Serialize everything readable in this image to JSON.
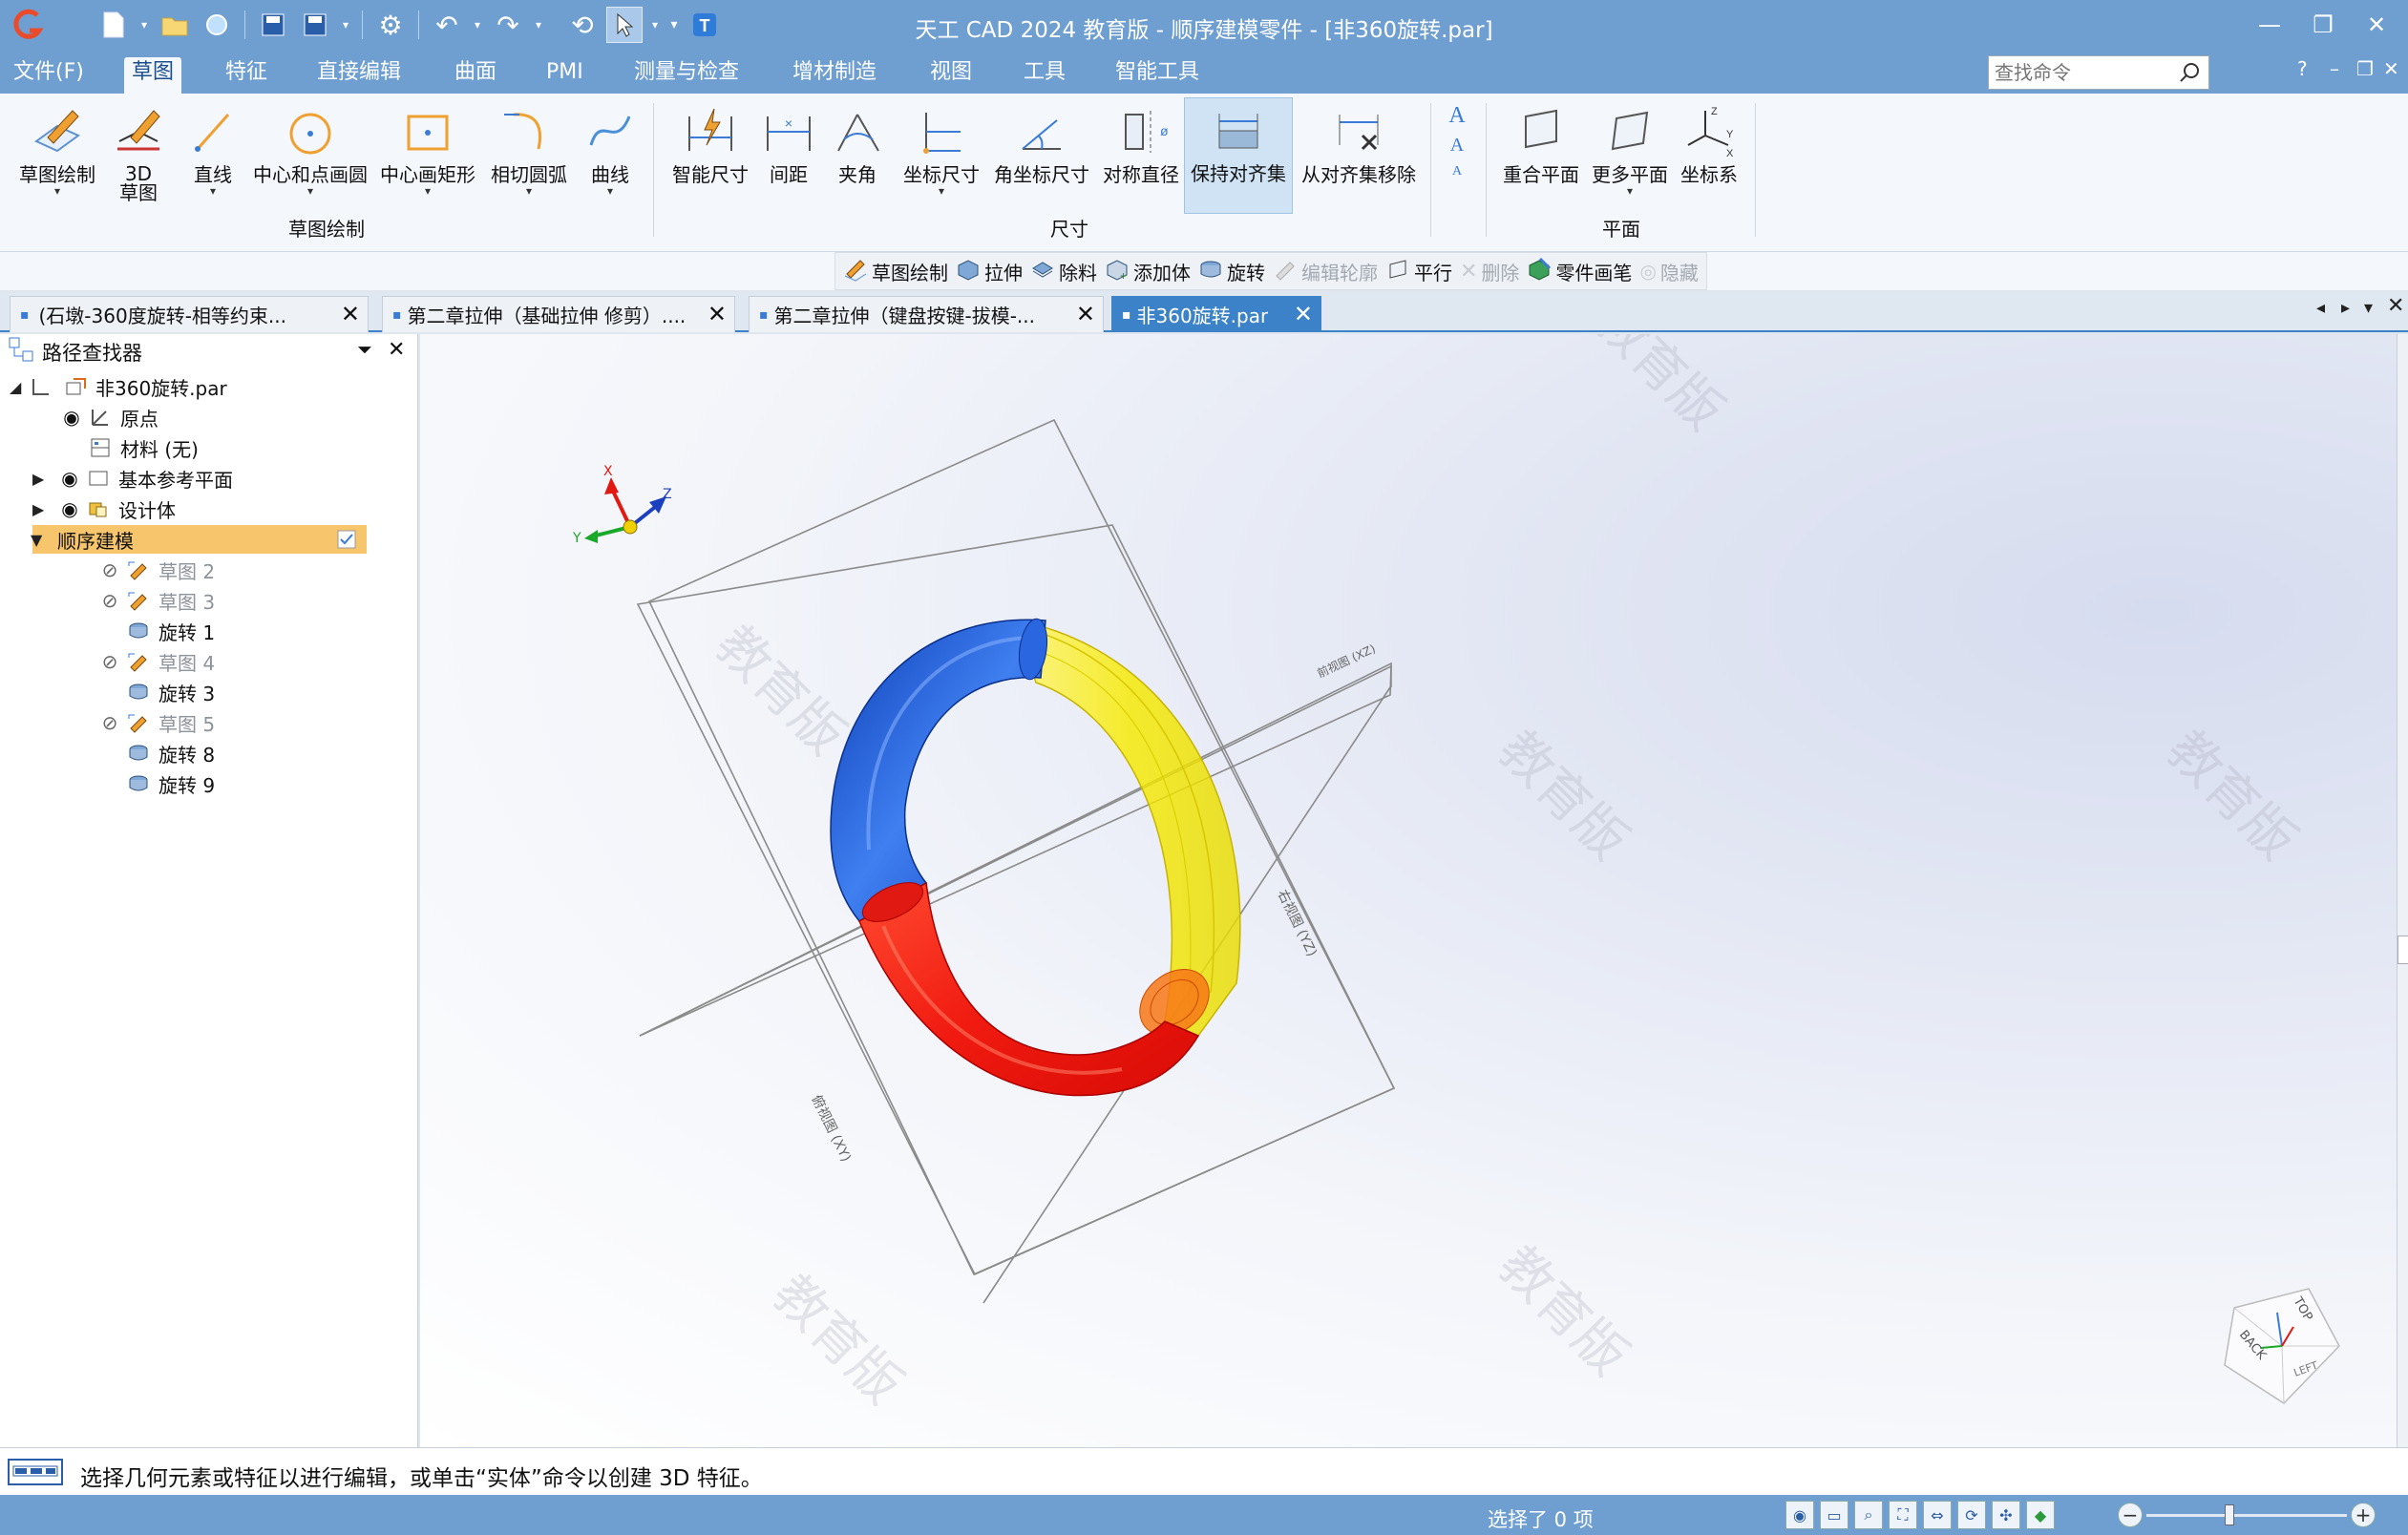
{
  "window": {
    "title": "天工 CAD 2024 教育版 - 顺序建模零件 - [非360旋转.par]"
  },
  "menu": {
    "items": [
      "文件(F)",
      "草图",
      "特征",
      "直接编辑",
      "曲面",
      "PMI",
      "测量与检查",
      "增材制造",
      "视图",
      "工具",
      "智能工具"
    ],
    "active_index": 1,
    "search_placeholder": "查找命令"
  },
  "ribbon": {
    "buttons": [
      {
        "label": "草图绘制",
        "icon": "sketch-pencil-icon"
      },
      {
        "label": "3D",
        "label2": "草图",
        "icon": "3d-sketch-icon"
      },
      {
        "label": "直线",
        "icon": "line-icon"
      },
      {
        "label": "中心和点画圆",
        "icon": "circle-center-icon"
      },
      {
        "label": "中心画矩形",
        "icon": "rectangle-center-icon"
      },
      {
        "label": "相切圆弧",
        "icon": "tangent-arc-icon"
      },
      {
        "label": "曲线",
        "icon": "curve-icon"
      },
      {
        "label": "智能尺寸",
        "icon": "smart-dimension-icon"
      },
      {
        "label": "间距",
        "icon": "distance-icon"
      },
      {
        "label": "夹角",
        "icon": "angle-icon"
      },
      {
        "label": "坐标尺寸",
        "icon": "coordinate-dimension-icon"
      },
      {
        "label": "角坐标尺寸",
        "icon": "angular-coordinate-icon"
      },
      {
        "label": "对称直径",
        "icon": "symmetric-diameter-icon"
      },
      {
        "label": "保持对齐集",
        "icon": "keep-align-set-icon"
      },
      {
        "label": "从对齐集移除",
        "icon": "remove-align-set-icon"
      },
      {
        "label": "重合平面",
        "icon": "coincident-plane-icon"
      },
      {
        "label": "更多平面",
        "icon": "more-planes-icon"
      },
      {
        "label": "坐标系",
        "icon": "coordinate-system-icon"
      }
    ],
    "groups": [
      "草图绘制",
      "尺寸",
      "平面"
    ]
  },
  "subtoolbar": {
    "items": [
      {
        "label": "草图绘制",
        "enabled": true
      },
      {
        "label": "拉伸",
        "enabled": true
      },
      {
        "label": "除料",
        "enabled": true
      },
      {
        "label": "添加体",
        "enabled": true
      },
      {
        "label": "旋转",
        "enabled": true
      },
      {
        "label": "编辑轮廓",
        "enabled": false
      },
      {
        "label": "平行",
        "enabled": true
      },
      {
        "label": "删除",
        "enabled": false
      },
      {
        "label": "零件画笔",
        "enabled": true
      },
      {
        "label": "隐藏",
        "enabled": false
      }
    ]
  },
  "tabs": [
    {
      "label": "(石墩-360度旋转-相等约束..."
    },
    {
      "label": "第二章拉伸（基础拉伸 修剪）...."
    },
    {
      "label": "第二章拉伸（键盘按键-拔模-..."
    },
    {
      "label": "非360旋转.par"
    }
  ],
  "active_tab": 3,
  "pathfinder": {
    "title": "路径查找器",
    "tree": [
      {
        "label": "非360旋转.par"
      },
      {
        "label": "原点"
      },
      {
        "label": "材料 (无)"
      },
      {
        "label": "基本参考平面"
      },
      {
        "label": "设计体"
      },
      {
        "label": "顺序建模"
      },
      {
        "label": "草图 2"
      },
      {
        "label": "草图 3"
      },
      {
        "label": "旋转 1"
      },
      {
        "label": "草图 4"
      },
      {
        "label": "旋转 3"
      },
      {
        "label": "草图 5"
      },
      {
        "label": "旋转 8"
      },
      {
        "label": "旋转 9"
      }
    ]
  },
  "viewport": {
    "watermark": "教育版",
    "plane_labels": [
      "前视图 (XZ)",
      "右视图 (YZ)",
      "俯视图 (XY)"
    ],
    "axis_labels": [
      "X",
      "Y",
      "Z"
    ],
    "viewcube_labels": [
      "TOP",
      "BACK",
      "LEFT"
    ],
    "colors": {
      "blue": "#1e5bd6",
      "yellow": "#f5e600",
      "red": "#ef1a12"
    }
  },
  "status": {
    "prompt": "选择几何元素或特征以进行编辑，或单击“实体”命令以创建 3D 特征。",
    "selection": "选择了 0 项"
  }
}
